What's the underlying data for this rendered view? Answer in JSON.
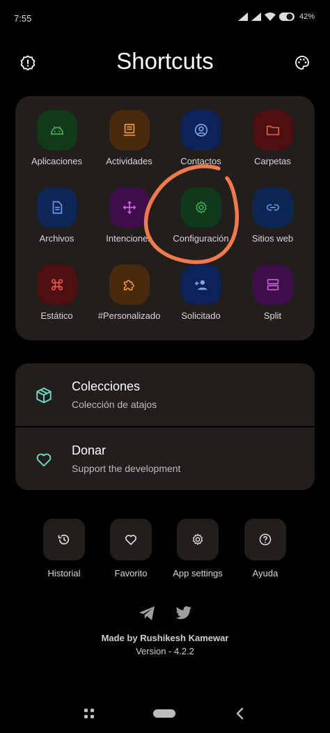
{
  "status_bar": {
    "time": "7:55",
    "battery": "42%"
  },
  "header": {
    "title": "Shortcuts",
    "left_icon": "alert-badge-icon",
    "right_icon": "palette-icon"
  },
  "grid": {
    "tiles": [
      {
        "label": "Aplicaciones",
        "icon": "android-icon",
        "bg": "#113a18",
        "fg": "#4fae5b"
      },
      {
        "label": "Actividades",
        "icon": "activity-icon",
        "bg": "#4a2a0d",
        "fg": "#ee9b4a"
      },
      {
        "label": "Contactos",
        "icon": "account-circle-icon",
        "bg": "#0c2258",
        "fg": "#7fa4ee"
      },
      {
        "label": "Carpetas",
        "icon": "folder-icon",
        "bg": "#4d0f0f",
        "fg": "#e95a5a"
      },
      {
        "label": "Archivos",
        "icon": "file-icon",
        "bg": "#0d2656",
        "fg": "#6f97ea"
      },
      {
        "label": "Intenciones",
        "icon": "intent-icon",
        "bg": "#3f0e4a",
        "fg": "#c466d8"
      },
      {
        "label": "Configuración",
        "icon": "gear-icon",
        "bg": "#10381a",
        "fg": "#45a757"
      },
      {
        "label": "Sitios web",
        "icon": "link-icon",
        "bg": "#0d2552",
        "fg": "#6995e4"
      },
      {
        "label": "Estático",
        "icon": "command-icon",
        "bg": "#4d0f0f",
        "fg": "#ea5454"
      },
      {
        "label": "#Personalizado",
        "icon": "puzzle-icon",
        "bg": "#4a2a0d",
        "fg": "#ef9548"
      },
      {
        "label": "Solicitado",
        "icon": "person-add-icon",
        "bg": "#0c2258",
        "fg": "#7fa4ee"
      },
      {
        "label": "Split",
        "icon": "split-icon",
        "bg": "#3f0e4a",
        "fg": "#c466d8"
      }
    ]
  },
  "list": {
    "items": [
      {
        "title": "Colecciones",
        "subtitle": "Colección de atajos",
        "icon": "package-icon"
      },
      {
        "title": "Donar",
        "subtitle": "Support the development",
        "icon": "heart-icon"
      }
    ],
    "accent": "#6fd6c4"
  },
  "quick_actions": [
    {
      "label": "Historial",
      "icon": "history-icon"
    },
    {
      "label": "Favorito",
      "icon": "heart-outline-icon"
    },
    {
      "label": "App settings",
      "icon": "gear-icon"
    },
    {
      "label": "Ayuda",
      "icon": "help-icon"
    }
  ],
  "social": [
    {
      "icon": "telegram-icon"
    },
    {
      "icon": "twitter-icon"
    }
  ],
  "footer": {
    "credits": "Made by Rushikesh Kamewar",
    "version": "Version - 4.2.2"
  },
  "annotation_color": "#f07a4a"
}
